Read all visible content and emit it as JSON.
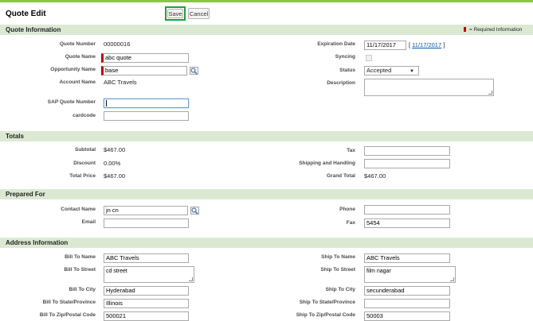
{
  "header": {
    "title": "Quote Edit",
    "save_label": "Save",
    "cancel_label": "Cancel"
  },
  "quote_info": {
    "section_title": "Quote Information",
    "required_legend": "= Required Information",
    "quote_number_label": "Quote Number",
    "quote_number": "00000016",
    "quote_name_label": "Quote Name",
    "quote_name": "abc quote",
    "opportunity_name_label": "Opportunity Name",
    "opportunity_name": "base",
    "account_name_label": "Account Name",
    "account_name": "ABC Travels",
    "sap_quote_number_label": "SAP Quote Number",
    "sap_quote_number": "",
    "cardcode_label": "cardcode",
    "cardcode": "",
    "expiration_date_label": "Expiration Date",
    "expiration_date": "11/17/2017",
    "expiration_today_link": "11/17/2017",
    "syncing_label": "Syncing",
    "status_label": "Status",
    "status": "Accepted",
    "description_label": "Description",
    "description": ""
  },
  "totals": {
    "section_title": "Totals",
    "subtotal_label": "Subtotal",
    "subtotal": "$467.00",
    "discount_label": "Discount",
    "discount": "0.00%",
    "total_price_label": "Total Price",
    "total_price": "$467.00",
    "tax_label": "Tax",
    "tax": "",
    "shipping_label": "Shipping and Handling",
    "shipping": "",
    "grand_total_label": "Grand Total",
    "grand_total": "$467.00"
  },
  "prepared_for": {
    "section_title": "Prepared For",
    "contact_name_label": "Contact Name",
    "contact_name": "jn cn",
    "email_label": "Email",
    "email": "",
    "phone_label": "Phone",
    "phone": "",
    "fax_label": "Fax",
    "fax": "5454"
  },
  "address": {
    "section_title": "Address Information",
    "bill_to_name_label": "Bill To Name",
    "bill_to_name": "ABC Travels",
    "bill_to_street_label": "Bill To Street",
    "bill_to_street": "cd street",
    "bill_to_city_label": "Bill To City",
    "bill_to_city": "Hyderabad",
    "bill_to_state_label": "Bill To State/Province",
    "bill_to_state": "Illinois",
    "bill_to_zip_label": "Bill To Zip/Postal Code",
    "bill_to_zip": "500021",
    "ship_to_name_label": "Ship To Name",
    "ship_to_name": "ABC Travels",
    "ship_to_street_label": "Ship To Street",
    "ship_to_street": "film nagar",
    "ship_to_city_label": "Ship To City",
    "ship_to_city": "secunderabad",
    "ship_to_state_label": "Ship To State/Province",
    "ship_to_state": "",
    "ship_to_zip_label": "Ship To Zip/Postal Code",
    "ship_to_zip": "50003"
  },
  "colors": {
    "section_bg": "#dbe9d3",
    "required": "#c00000",
    "save_highlight": "#1fa03a",
    "link": "#015ba7"
  }
}
